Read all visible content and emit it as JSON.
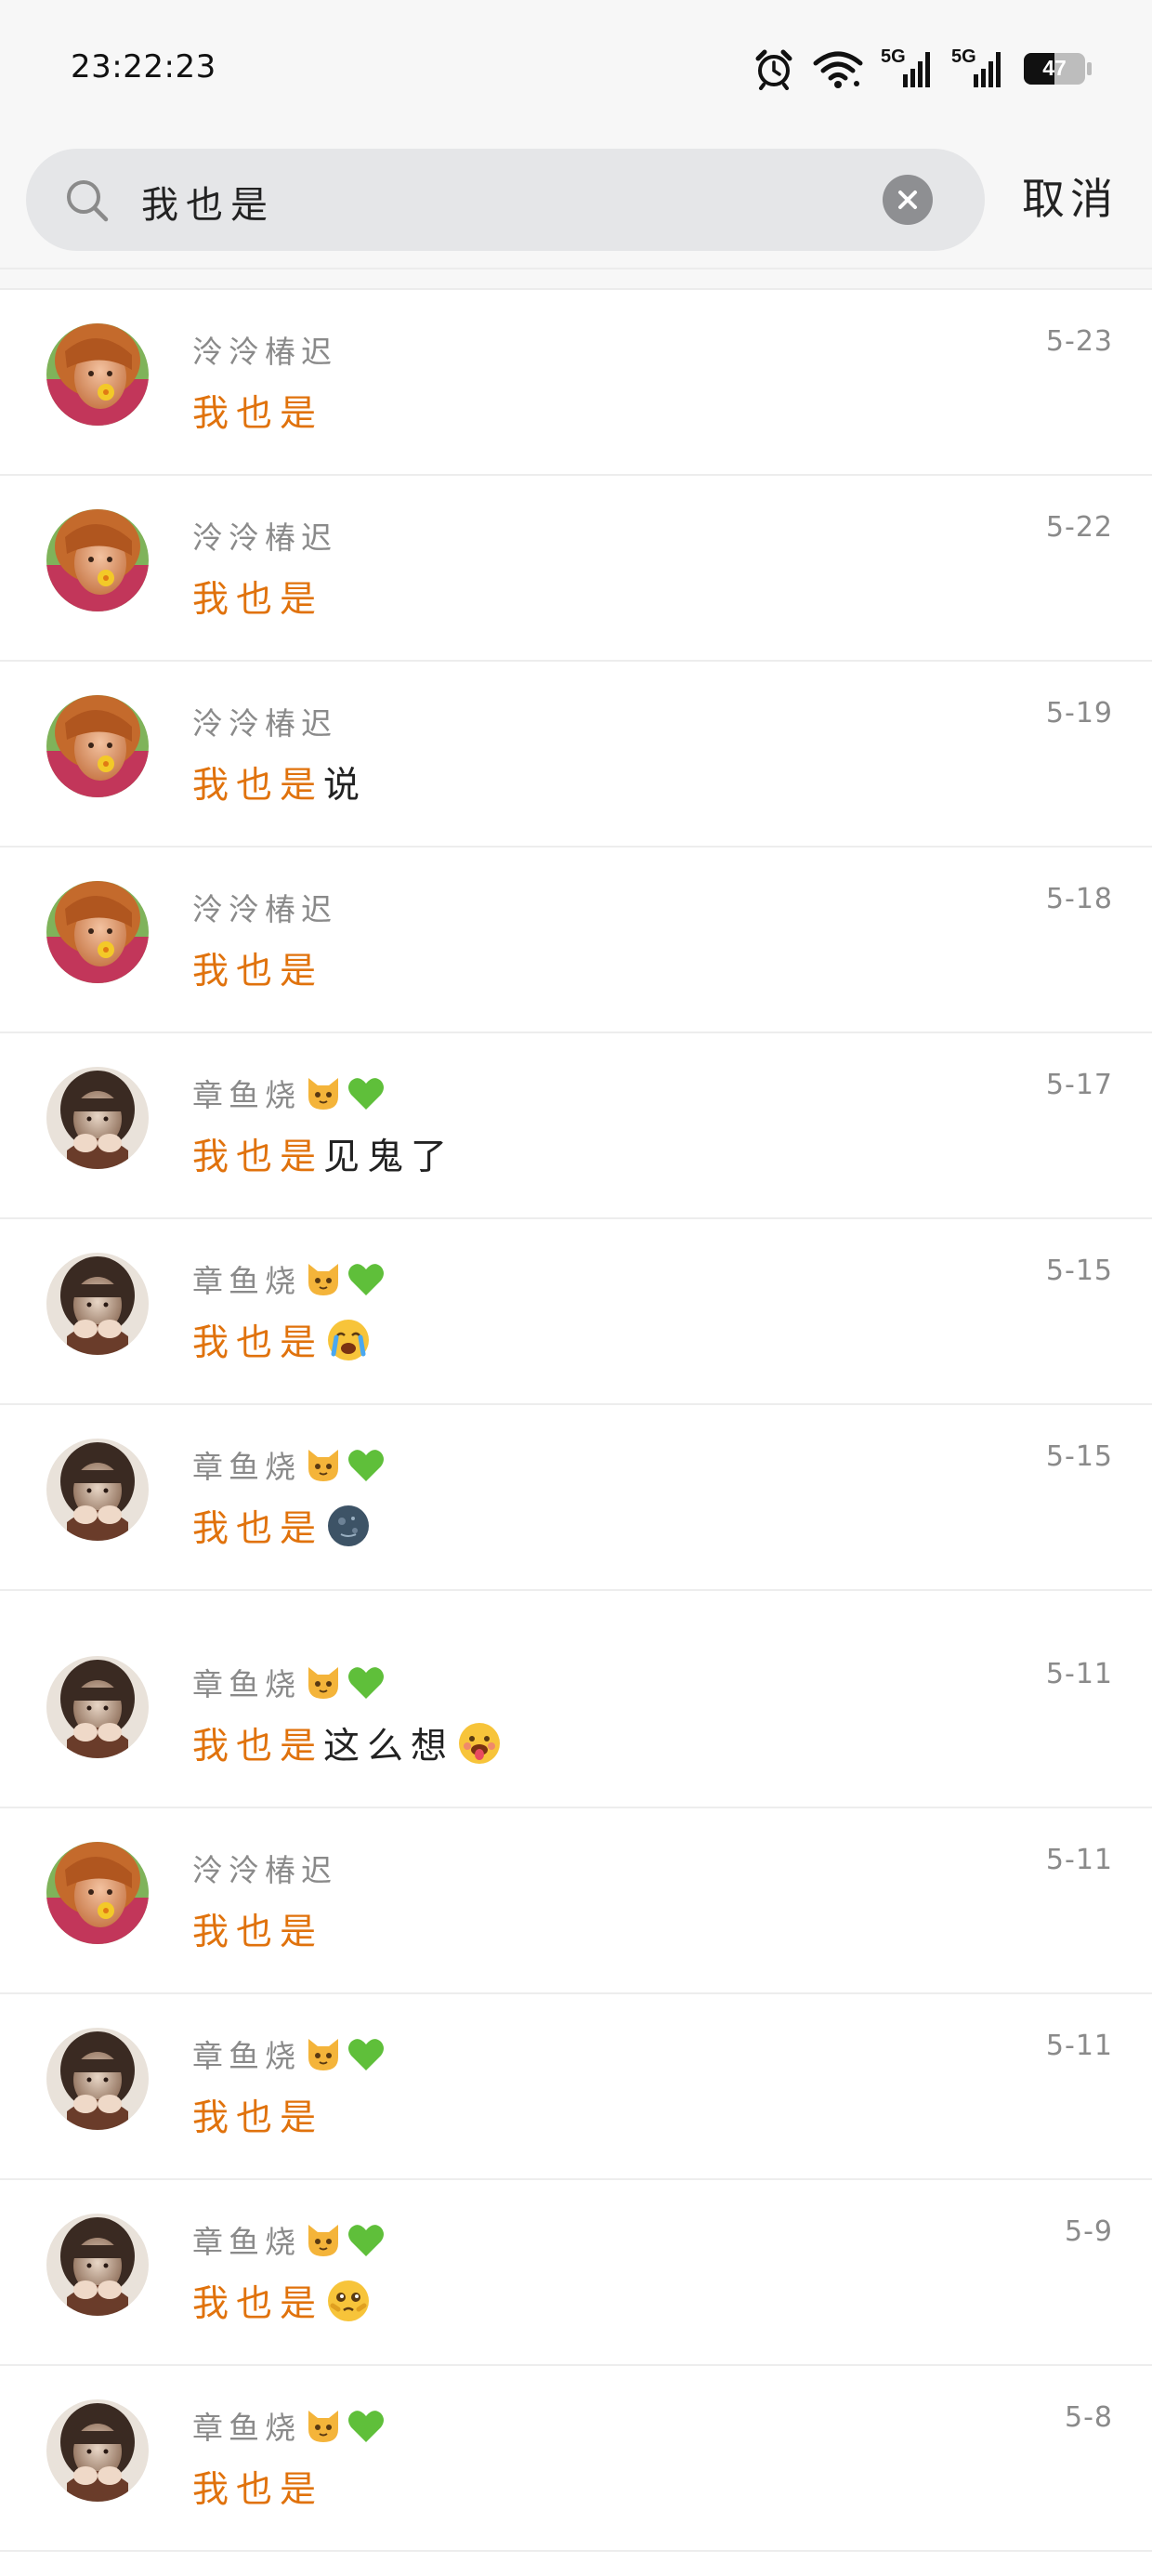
{
  "status_bar": {
    "time": "23:22:23",
    "network_1": "5G",
    "network_2": "5G",
    "battery": "47"
  },
  "search": {
    "query": "我也是",
    "cancel_label": "取消"
  },
  "colors": {
    "highlight": "#e0720c"
  },
  "results": [
    {
      "name": "泠泠椿迟",
      "name_emojis": [],
      "date": "5-23",
      "match": "我也是",
      "rest": "",
      "msg_emoji": null,
      "avatar": "avatar-a"
    },
    {
      "name": "泠泠椿迟",
      "name_emojis": [],
      "date": "5-22",
      "match": "我也是",
      "rest": "",
      "msg_emoji": null,
      "avatar": "avatar-a"
    },
    {
      "name": "泠泠椿迟",
      "name_emojis": [],
      "date": "5-19",
      "match": "我也是",
      "rest": "说",
      "msg_emoji": null,
      "avatar": "avatar-a"
    },
    {
      "name": "泠泠椿迟",
      "name_emojis": [],
      "date": "5-18",
      "match": "我也是",
      "rest": "",
      "msg_emoji": null,
      "avatar": "avatar-a"
    },
    {
      "name": "章鱼烧",
      "name_emojis": [
        "cat-face-icon",
        "green-heart-icon"
      ],
      "date": "5-17",
      "match": "我也是",
      "rest": "见鬼了",
      "msg_emoji": null,
      "avatar": "avatar-b"
    },
    {
      "name": "章鱼烧",
      "name_emojis": [
        "cat-face-icon",
        "green-heart-icon"
      ],
      "date": "5-15",
      "match": "我也是",
      "rest": "",
      "msg_emoji": "crying-face-icon",
      "avatar": "avatar-b"
    },
    {
      "name": "章鱼烧",
      "name_emojis": [
        "cat-face-icon",
        "green-heart-icon"
      ],
      "date": "5-15",
      "match": "我也是",
      "rest": "",
      "msg_emoji": "new-moon-face-icon",
      "avatar": "avatar-b"
    },
    {
      "name": "章鱼烧",
      "name_emojis": [
        "cat-face-icon",
        "green-heart-icon"
      ],
      "date": "5-11",
      "match": "我也是",
      "rest": "这么想",
      "msg_emoji": "tongue-face-icon",
      "avatar": "avatar-b"
    },
    {
      "name": "泠泠椿迟",
      "name_emojis": [],
      "date": "5-11",
      "match": "我也是",
      "rest": "",
      "msg_emoji": null,
      "avatar": "avatar-a"
    },
    {
      "name": "章鱼烧",
      "name_emojis": [
        "cat-face-icon",
        "green-heart-icon"
      ],
      "date": "5-11",
      "match": "我也是",
      "rest": "",
      "msg_emoji": null,
      "avatar": "avatar-b"
    },
    {
      "name": "章鱼烧",
      "name_emojis": [
        "cat-face-icon",
        "green-heart-icon"
      ],
      "date": "5-9",
      "match": "我也是",
      "rest": "",
      "msg_emoji": "pleading-face-icon",
      "avatar": "avatar-b"
    },
    {
      "name": "章鱼烧",
      "name_emojis": [
        "cat-face-icon",
        "green-heart-icon"
      ],
      "date": "5-8",
      "match": "我也是",
      "rest": "",
      "msg_emoji": null,
      "avatar": "avatar-b"
    }
  ]
}
